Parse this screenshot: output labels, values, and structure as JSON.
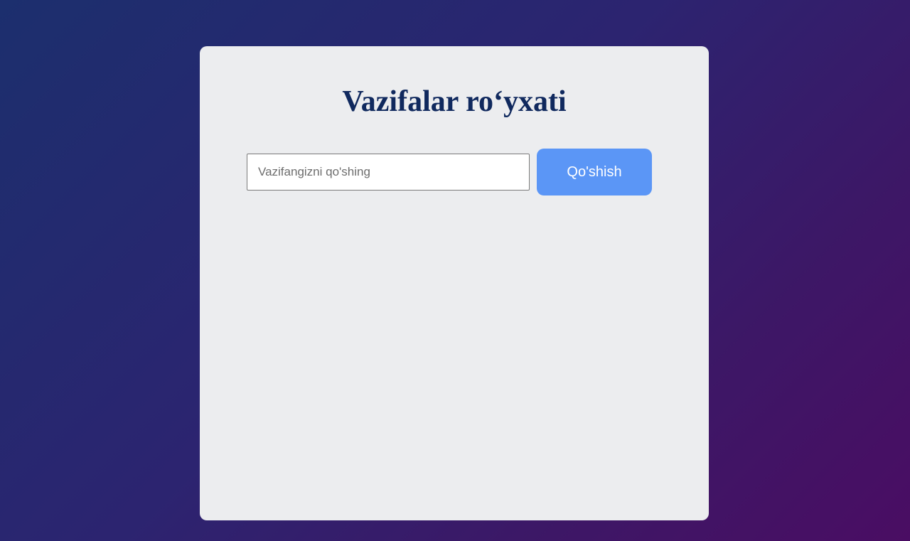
{
  "app": {
    "title": "Vazifalar ro‘yxati"
  },
  "form": {
    "input_value": "",
    "input_placeholder": "Vazifangizni qo'shing",
    "add_button_label": "Qo'shish"
  },
  "tasks": [],
  "colors": {
    "background_start": "#1c2f6e",
    "background_end": "#4a0d63",
    "card": "#ecedef",
    "title": "#10295e",
    "button": "#5b96f6",
    "button_text": "#ffffff"
  }
}
